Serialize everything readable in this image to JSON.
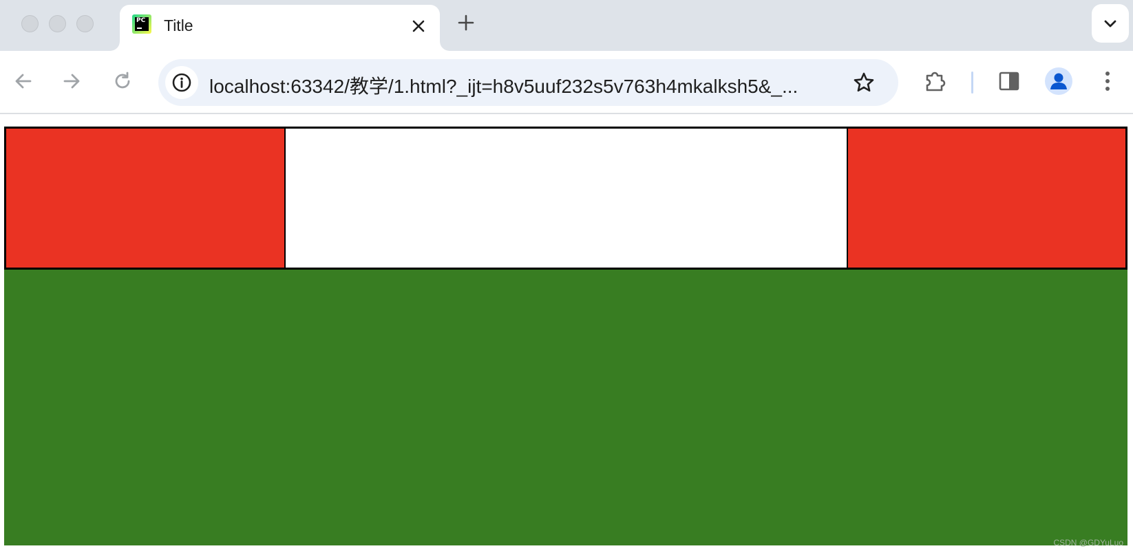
{
  "window": {
    "traffic_lights": [
      "close",
      "minimize",
      "zoom"
    ]
  },
  "tab": {
    "title": "Title",
    "favicon_text": "PC",
    "favicon_icon": "pycharm-icon"
  },
  "toolbar": {
    "url": "localhost:63342/教学/1.html?_ijt=h8v5uuf232s5v763h4mkalksh5&_...",
    "icons": [
      "back-icon",
      "forward-icon",
      "reload-icon",
      "info-icon",
      "star-icon",
      "extensions-icon",
      "side-panel-icon",
      "profile-icon",
      "menu-icon"
    ]
  },
  "page": {
    "left_box_color": "#ea3323",
    "right_box_color": "#ea3323",
    "middle_color": "#ffffff",
    "bottom_color": "#387d22",
    "border_color": "#000000"
  },
  "watermark": "CSDN @GDYuLuo"
}
